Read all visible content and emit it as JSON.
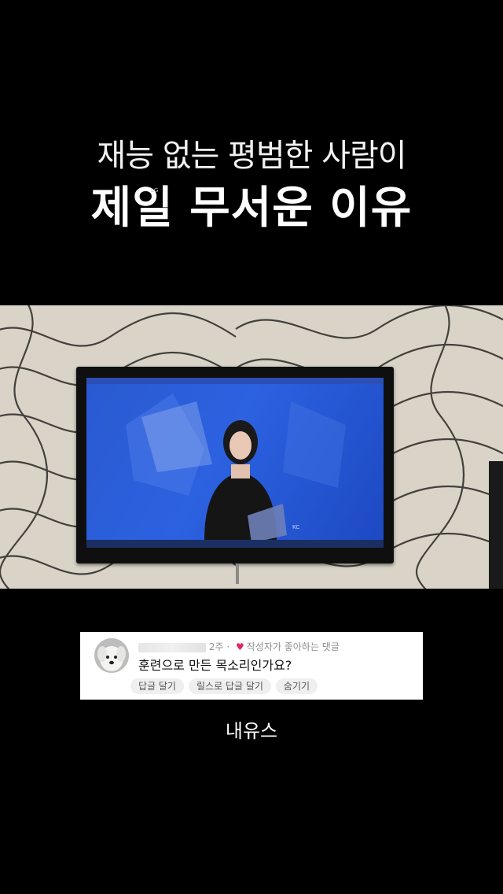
{
  "title": {
    "line1": "재능 없는 평범한 사람이",
    "line2": "제일 무서운 이유"
  },
  "comment": {
    "time": "2주",
    "author_liked_label": "작성자가 좋아하는 댓글",
    "text": "훈련으로 만든 목소리인가요?",
    "actions": {
      "reply": "답글 달기",
      "reels_reply": "릴스로 답글 달기",
      "hide": "숨기기"
    },
    "heart_color": "#e0245e"
  },
  "caption": "내유스",
  "icons": {
    "heart": "heart-icon",
    "avatar": "avatar"
  }
}
